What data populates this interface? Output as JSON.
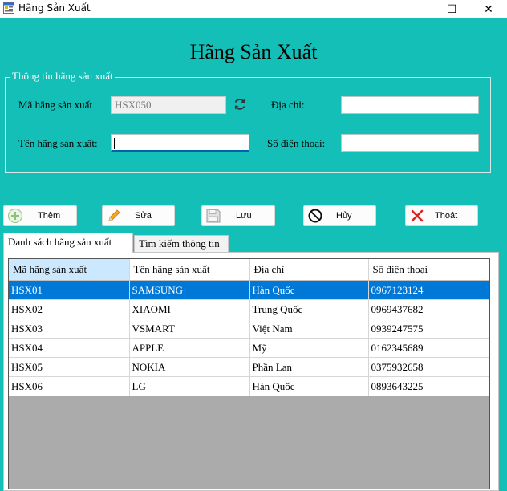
{
  "window": {
    "title": "Hãng Sản Xuất",
    "controls": {
      "minimize": "—",
      "maximize": "☐",
      "close": "✕"
    }
  },
  "page_title": "Hãng Sản Xuất",
  "info_group": {
    "legend": "Thông tin hãng sản xuất",
    "ma_label": "Mã hãng sản xuất",
    "ma_value": "HSX050",
    "ten_label": "Tên hãng sản xuất:",
    "ten_value": "",
    "diachi_label": "Địa chỉ:",
    "diachi_value": "",
    "sdt_label": "Số điện thoại:",
    "sdt_value": ""
  },
  "toolbar": {
    "them": "Thêm",
    "sua": "Sửa",
    "luu": "Lưu",
    "huy": "Hủy",
    "thoat": "Thoát"
  },
  "tabs": [
    {
      "label": "Danh sách hãng sản xuất",
      "active": true
    },
    {
      "label": "Tìm kiếm thông tin",
      "active": false
    }
  ],
  "grid": {
    "columns": [
      "Mã hãng sản xuất",
      "Tên hãng sản xuất",
      "Địa chỉ",
      "Số điện thoại"
    ],
    "rows": [
      [
        "HSX01",
        "SAMSUNG",
        "Hàn Quốc",
        "0967123124"
      ],
      [
        "HSX02",
        "XIAOMI",
        "Trung Quốc",
        "0969437682"
      ],
      [
        "HSX03",
        "VSMART",
        "Việt Nam",
        "0939247575"
      ],
      [
        "HSX04",
        "APPLE",
        "Mỹ",
        "0162345689"
      ],
      [
        "HSX05",
        "NOKIA",
        "Phần Lan",
        "0375932658"
      ],
      [
        "HSX06",
        "LG",
        "Hàn Quốc",
        "0893643225"
      ]
    ],
    "selected_row": 0
  },
  "colors": {
    "background": "#14bfb7",
    "selection": "#0078d7",
    "grid_empty": "#ababab"
  }
}
